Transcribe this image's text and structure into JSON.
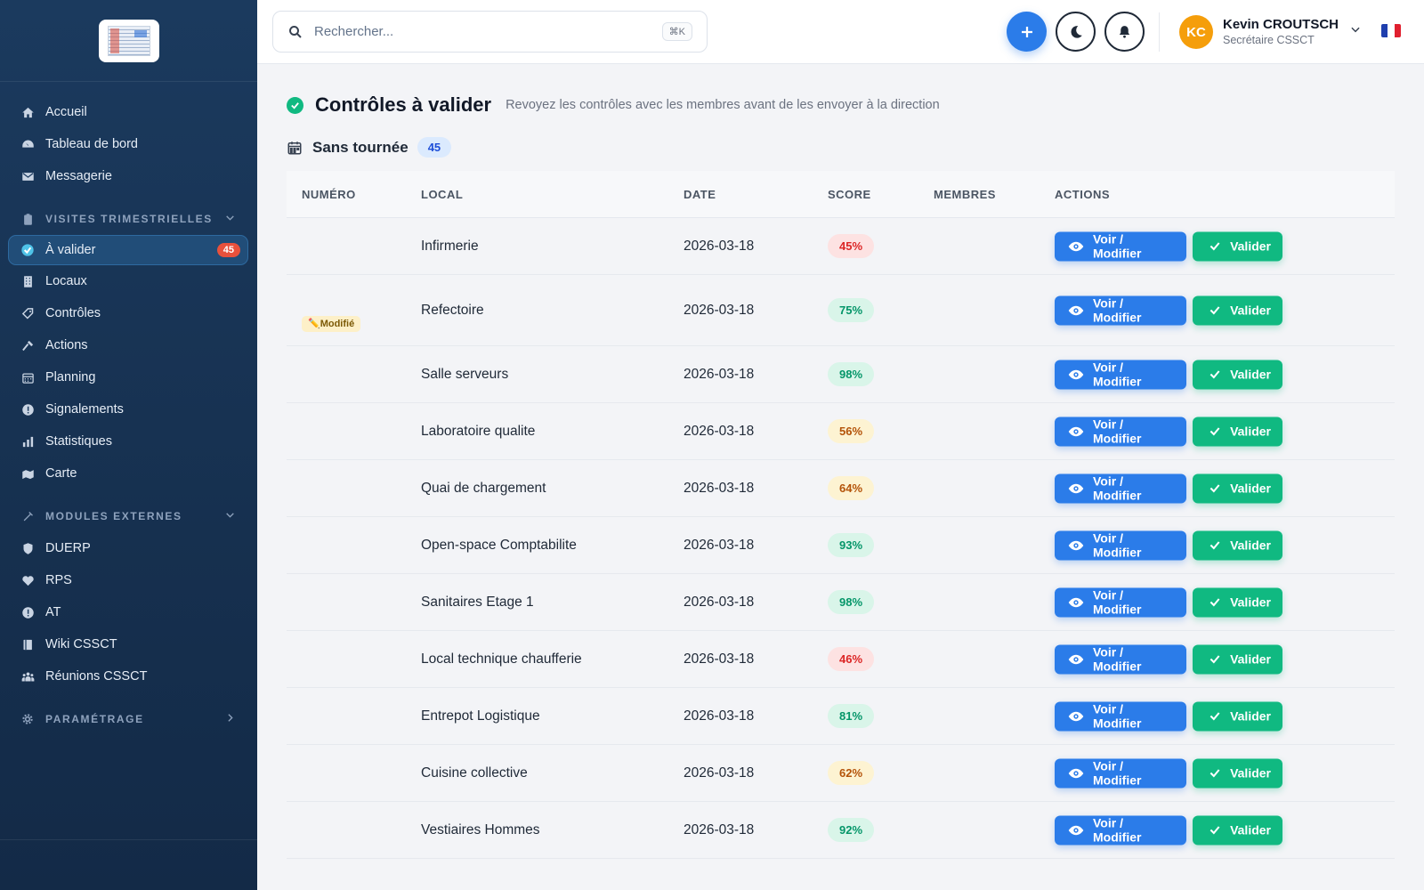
{
  "sidebar": {
    "items": [
      {
        "label": "Accueil",
        "icon": "home-icon"
      },
      {
        "label": "Tableau de bord",
        "icon": "dashboard-icon"
      },
      {
        "label": "Messagerie",
        "icon": "mail-icon"
      }
    ],
    "section_visites": "VISITES TRIMESTRIELLES",
    "visites_items": [
      {
        "label": "À valider",
        "icon": "check-circle-icon",
        "badge": "45",
        "active": true
      },
      {
        "label": "Locaux",
        "icon": "building-icon"
      },
      {
        "label": "Contrôles",
        "icon": "tag-icon"
      },
      {
        "label": "Actions",
        "icon": "hammer-icon"
      },
      {
        "label": "Planning",
        "icon": "calendar-icon"
      },
      {
        "label": "Signalements",
        "icon": "alert-icon"
      },
      {
        "label": "Statistiques",
        "icon": "bar-chart-icon"
      },
      {
        "label": "Carte",
        "icon": "map-icon"
      }
    ],
    "section_modules": "MODULES EXTERNES",
    "modules_items": [
      {
        "label": "DUERP",
        "icon": "shield-icon"
      },
      {
        "label": "RPS",
        "icon": "heart-icon"
      },
      {
        "label": "AT",
        "icon": "alert-icon"
      },
      {
        "label": "Wiki CSSCT",
        "icon": "book-icon"
      },
      {
        "label": "Réunions CSSCT",
        "icon": "users-icon"
      }
    ],
    "section_param": "PARAMÉTRAGE"
  },
  "topbar": {
    "search_placeholder": "Rechercher...",
    "search_shortcut": "⌘K",
    "user_initials": "KC",
    "user_name": "Kevin CROUTSCH",
    "user_role": "Secrétaire CSSCT",
    "language_flag": "fr"
  },
  "page": {
    "title": "Contrôles à valider",
    "subtitle": "Revoyez les contrôles avec les membres avant de les envoyer à la direction",
    "group_title": "Sans tournée",
    "group_count": "45"
  },
  "table": {
    "headers": [
      "NUMÉRO",
      "LOCAL",
      "DATE",
      "SCORE",
      "MEMBRES",
      "ACTIONS"
    ],
    "view_label": "Voir / Modifier",
    "validate_label": "Valider",
    "rows": [
      {
        "numero": "",
        "local": "Infirmerie",
        "date": "2026-03-18",
        "score": "45%",
        "level": "red"
      },
      {
        "numero": "Modifié",
        "local": "Refectoire",
        "date": "2026-03-18",
        "score": "75%",
        "level": "green"
      },
      {
        "numero": "",
        "local": "Salle serveurs",
        "date": "2026-03-18",
        "score": "98%",
        "level": "green"
      },
      {
        "numero": "",
        "local": "Laboratoire qualite",
        "date": "2026-03-18",
        "score": "56%",
        "level": "yellow"
      },
      {
        "numero": "",
        "local": "Quai de chargement",
        "date": "2026-03-18",
        "score": "64%",
        "level": "yellow"
      },
      {
        "numero": "",
        "local": "Open-space Comptabilite",
        "date": "2026-03-18",
        "score": "93%",
        "level": "green"
      },
      {
        "numero": "",
        "local": "Sanitaires Etage 1",
        "date": "2026-03-18",
        "score": "98%",
        "level": "green"
      },
      {
        "numero": "",
        "local": "Local technique chaufferie",
        "date": "2026-03-18",
        "score": "46%",
        "level": "red"
      },
      {
        "numero": "",
        "local": "Entrepot Logistique",
        "date": "2026-03-18",
        "score": "81%",
        "level": "green"
      },
      {
        "numero": "",
        "local": "Cuisine collective",
        "date": "2026-03-18",
        "score": "62%",
        "level": "yellow"
      },
      {
        "numero": "",
        "local": "Vestiaires Hommes",
        "date": "2026-03-18",
        "score": "92%",
        "level": "green"
      }
    ]
  },
  "colors": {
    "primary": "#2b7ce9",
    "success": "#10b981",
    "danger": "#dc2626",
    "warning": "#b45309",
    "sidebar": "#1b3a5e"
  }
}
